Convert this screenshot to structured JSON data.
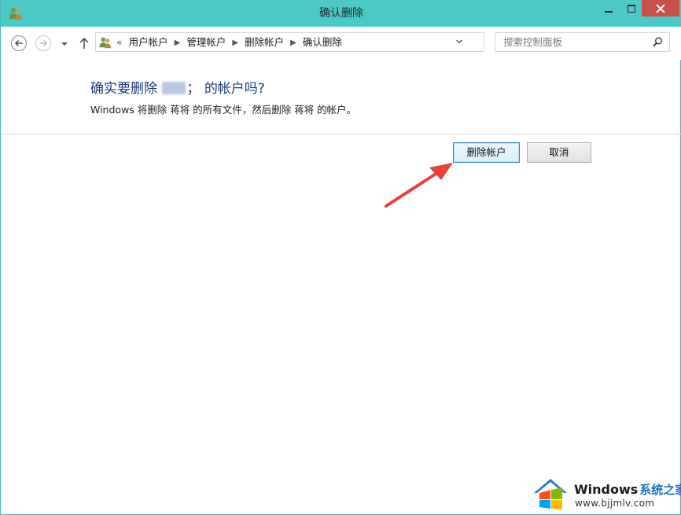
{
  "window": {
    "title": "确认删除",
    "icons": {
      "app": "users-icon",
      "minimize": "minimize-icon",
      "maximize": "maximize-icon",
      "close": "close-icon"
    }
  },
  "nav": {
    "breadcrumb_lead": "«",
    "breadcrumbs": [
      "用户帐户",
      "管理帐户",
      "删除帐户",
      "确认删除"
    ],
    "search_placeholder": "搜索控制面板",
    "icons": [
      "back-arrow-icon",
      "forward-arrow-icon",
      "recent-dropdown-icon",
      "up-arrow-icon",
      "users-icon",
      "chevron-down-icon",
      "refresh-icon",
      "search-icon"
    ]
  },
  "content": {
    "question_before": "确实要删除",
    "question_after": "的帐户吗?",
    "question_partial": "；",
    "description": "Windows 将删除 蒋将 的所有文件，然后删除 蒋将 的帐户。",
    "delete_label": "删除帐户",
    "cancel_label": "取消",
    "arrow_color": "#e8403c"
  },
  "watermark": {
    "brand": "Windows",
    "brand_cn": "系统之家",
    "url": "www.bjjmlv.com",
    "logo": "windows-logo-icon"
  }
}
